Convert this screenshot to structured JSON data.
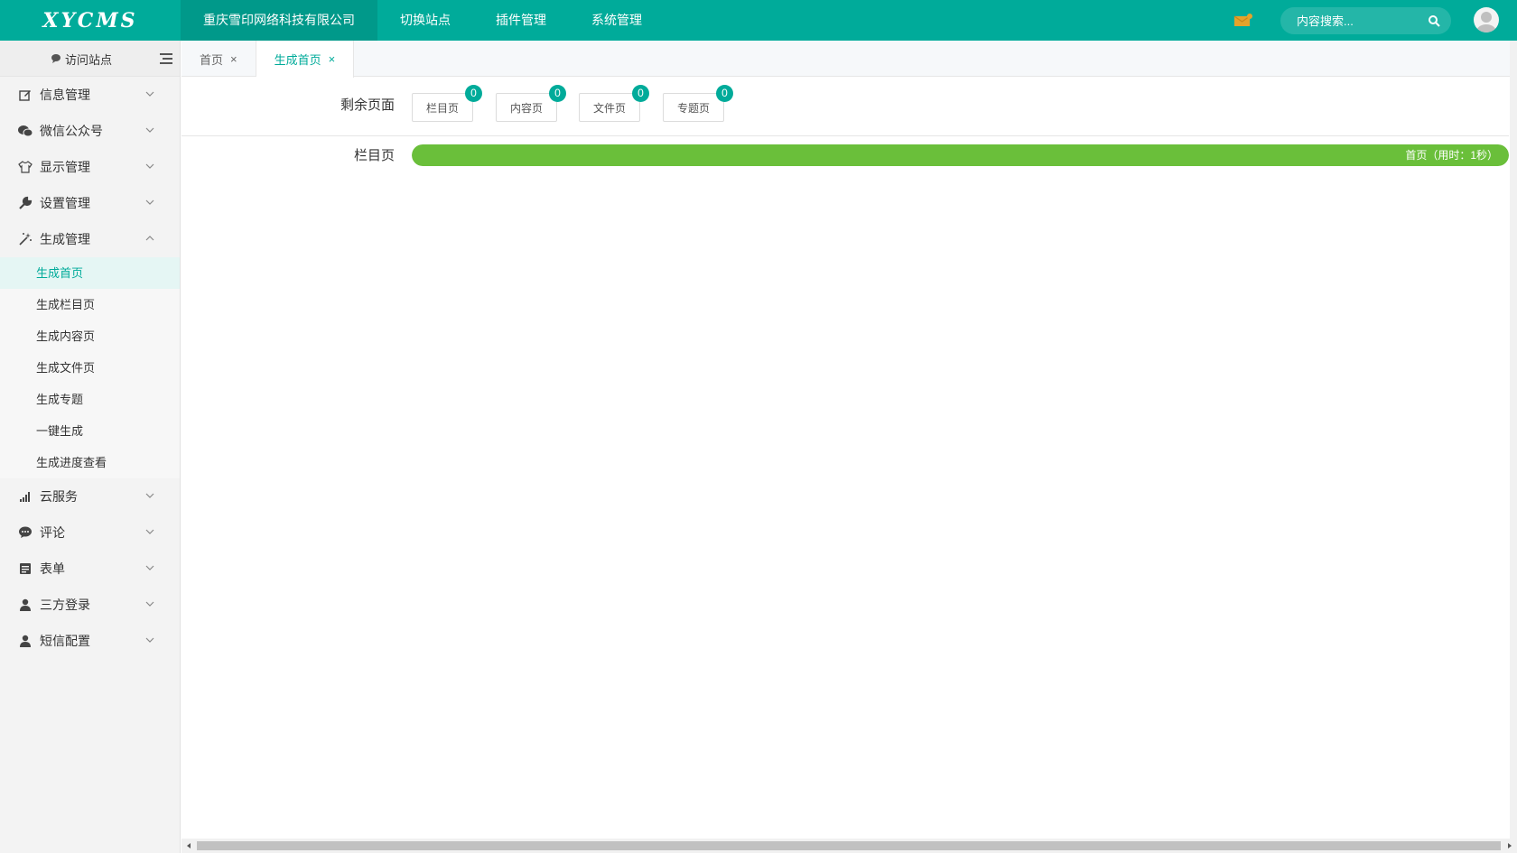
{
  "app": {
    "logo": "XYCMS"
  },
  "topnav": [
    {
      "label": "重庆雪印网络科技有限公司",
      "active": true
    },
    {
      "label": "切换站点"
    },
    {
      "label": "插件管理"
    },
    {
      "label": "系统管理"
    }
  ],
  "search": {
    "placeholder": "内容搜索..."
  },
  "colors": {
    "accent": "#00ab9a",
    "progress": "#6abf3a",
    "mail": "#e5a32b"
  },
  "sidebar": {
    "visit_label": "访问站点",
    "menus": [
      {
        "label": "信息管理",
        "icon": "edit-icon"
      },
      {
        "label": "微信公众号",
        "icon": "wechat-icon"
      },
      {
        "label": "显示管理",
        "icon": "tshirt-icon"
      },
      {
        "label": "设置管理",
        "icon": "wrench-icon"
      },
      {
        "label": "生成管理",
        "icon": "magic-wand-icon",
        "expanded": true
      }
    ],
    "submenu": [
      {
        "label": "生成首页",
        "active": true
      },
      {
        "label": "生成栏目页"
      },
      {
        "label": "生成内容页"
      },
      {
        "label": "生成文件页"
      },
      {
        "label": "生成专题"
      },
      {
        "label": "一键生成"
      },
      {
        "label": "生成进度查看"
      }
    ],
    "menus_after": [
      {
        "label": "云服务",
        "icon": "signal-icon"
      },
      {
        "label": "评论",
        "icon": "comment-icon"
      },
      {
        "label": "表单",
        "icon": "form-icon"
      },
      {
        "label": "三方登录",
        "icon": "user-icon"
      },
      {
        "label": "短信配置",
        "icon": "user-icon"
      }
    ]
  },
  "tabs": [
    {
      "label": "首页",
      "close": "×"
    },
    {
      "label": "生成首页",
      "close": "×",
      "active": true
    }
  ],
  "remaining": {
    "label": "剩余页面",
    "buttons": [
      {
        "label": "栏目页",
        "count": "0"
      },
      {
        "label": "内容页",
        "count": "0"
      },
      {
        "label": "文件页",
        "count": "0"
      },
      {
        "label": "专题页",
        "count": "0"
      }
    ]
  },
  "progress": {
    "label": "栏目页",
    "text": "首页（用时：1秒）",
    "fraction": 1.0
  }
}
